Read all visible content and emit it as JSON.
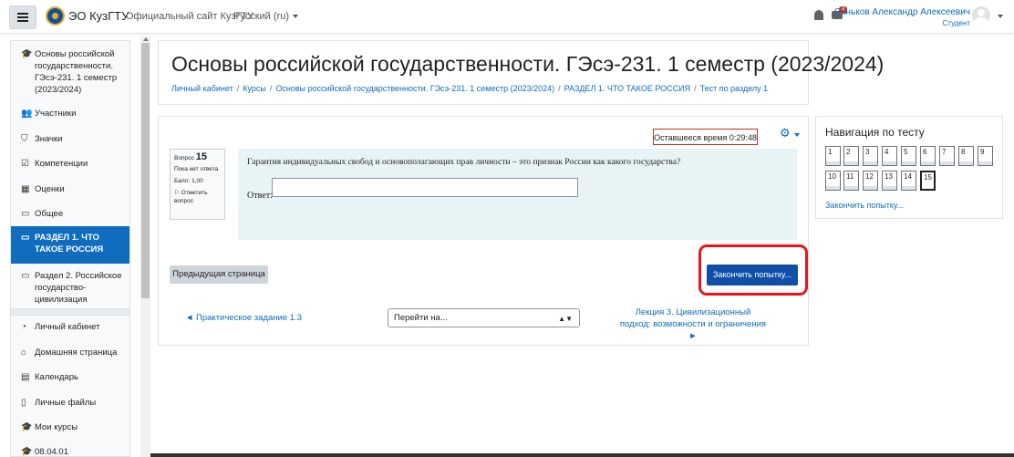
{
  "navbar": {
    "brand": "ЭО КузГТУ",
    "official_site": "Официальный сайт КузГТУ",
    "language": "Русский (ru)",
    "messages_badge": "4",
    "user_name": "Синьков Александр Алексеевич",
    "user_role": "Студент"
  },
  "sidebar": {
    "items": [
      {
        "label": "Основы российской государственности. ГЭсэ-231. 1 семестр (2023/2024)",
        "icon": "graduation-cap-icon"
      },
      {
        "label": "Участники",
        "icon": "users-icon"
      },
      {
        "label": "Значки",
        "icon": "shield-icon"
      },
      {
        "label": "Компетенции",
        "icon": "check-square-icon"
      },
      {
        "label": "Оценки",
        "icon": "table-icon"
      },
      {
        "label": "Общее",
        "icon": "folder-icon"
      },
      {
        "label": "РАЗДЕЛ 1. ЧТО ТАКОЕ РОССИЯ",
        "icon": "folder-icon",
        "active": true
      },
      {
        "label": "Раздел 2. Российское государство-цивилизация",
        "icon": "folder-icon"
      },
      {
        "label": "Личный кабинет",
        "icon": "dashboard-icon"
      },
      {
        "label": "Домашняя страница",
        "icon": "home-icon"
      },
      {
        "label": "Календарь",
        "icon": "calendar-icon"
      },
      {
        "label": "Личные файлы",
        "icon": "file-icon"
      },
      {
        "label": "Мои курсы",
        "icon": "graduation-cap-icon"
      },
      {
        "label": "08.04.01",
        "icon": "graduation-cap-icon"
      }
    ]
  },
  "header": {
    "title": "Основы российской государственности. ГЭсэ-231. 1 семестр (2023/2024)",
    "breadcrumbs": [
      "Личный кабинет",
      "Курсы",
      "Основы российской государственности. ГЭсэ-231. 1 семестр (2023/2024)",
      "РАЗДЕЛ 1. ЧТО ТАКОЕ РОССИЯ",
      "Тест по разделу 1"
    ]
  },
  "quiz": {
    "timer": "Оставшееся время 0:29:48",
    "question_label": "Вопрос",
    "question_number": "15",
    "status": "Пока нет ответа",
    "mark": "Балл: 1,00",
    "flag": "Отметить вопрос",
    "question_text": "Гарантия индивидуальных свобод и основополагающих прав личности – это признак России как какого государства?",
    "answer_label": "Ответ:",
    "answer_value": "",
    "prev_button": "Предыдущая страница",
    "finish_button": "Закончить попытку...",
    "prev_activity": "◄ Практическое задание 1.3",
    "jump_to": "Перейти на...",
    "next_activity": "Лекция 3. Цивилизационный подход: возможности и ограничения ►"
  },
  "quiz_nav": {
    "heading": "Навигация по тесту",
    "buttons": [
      "1",
      "2",
      "3",
      "4",
      "5",
      "6",
      "7",
      "8",
      "9",
      "10",
      "11",
      "12",
      "13",
      "14",
      "15"
    ],
    "current": "15",
    "finish_link": "Закончить попытку..."
  },
  "colors": {
    "primary": "#0f6cbf",
    "finish_button": "#0f4fa8",
    "timer_border": "#ca3120",
    "highlight_frame": "#e8151b",
    "question_bg": "#e7f3f5"
  }
}
